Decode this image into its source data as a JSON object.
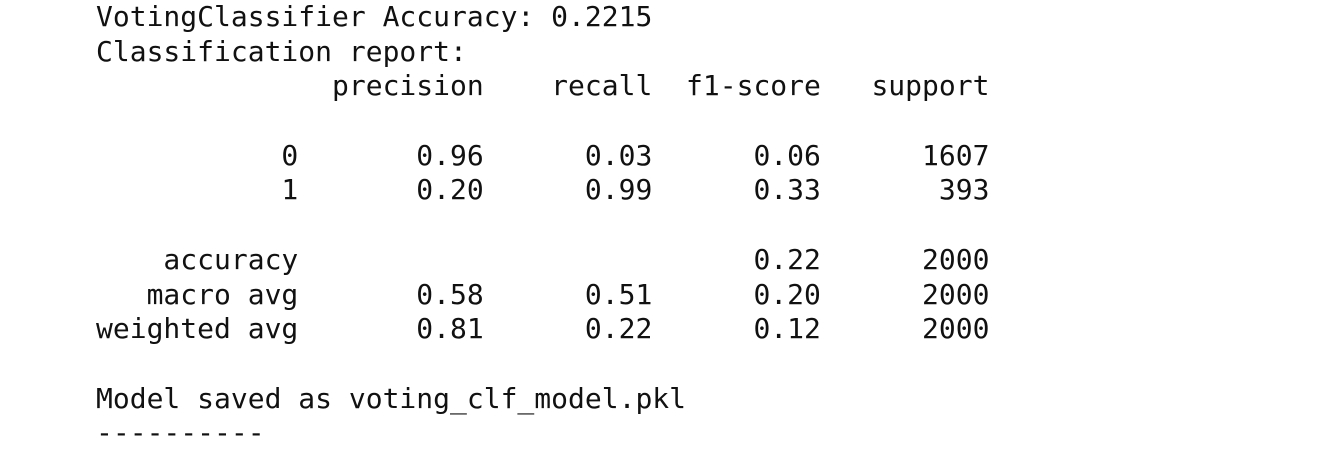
{
  "output_lines": [
    "VotingClassifier Accuracy: 0.2215",
    "Classification report:",
    "              precision    recall  f1-score   support",
    "",
    "           0       0.96      0.03      0.06      1607",
    "           1       0.20      0.99      0.33       393",
    "",
    "    accuracy                           0.22      2000",
    "   macro avg       0.58      0.51      0.20      2000",
    "weighted avg       0.81      0.22      0.12      2000",
    "",
    "Model saved as voting_clf_model.pkl",
    "----------"
  ]
}
